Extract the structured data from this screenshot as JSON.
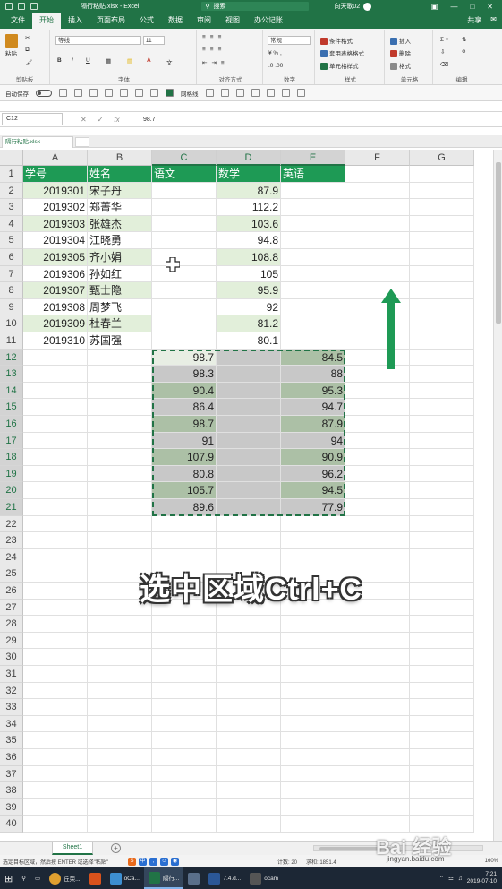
{
  "titlebar": {
    "title": "隔行粘贴.xlsx  -  Excel",
    "search": "搜索",
    "user": "向天歌02",
    "share": "共享"
  },
  "tabs": [
    "文件",
    "开始",
    "插入",
    "页面布局",
    "公式",
    "数据",
    "审阅",
    "视图",
    "办公记账"
  ],
  "ribbon": {
    "paste": "粘贴",
    "clipboard_label": "剪贴板",
    "font_name": "等线",
    "font_size": "11",
    "font_label": "字体",
    "align_label": "对齐方式",
    "number_format": "常规",
    "number_label": "数字",
    "cond_format": "条件格式",
    "table_format": "套用表格格式",
    "cell_style": "单元格样式",
    "style_label": "样式",
    "insert": "插入",
    "delete": "删除",
    "format": "格式",
    "cells_label": "单元格",
    "edit_label": "编辑"
  },
  "qbar": {
    "autosave": "自动保存",
    "gridlines": "网格线"
  },
  "formula": {
    "cell_ref": "C12",
    "value": "98.7"
  },
  "workbook_tab": "隔行粘贴.xlsx",
  "columns": [
    "A",
    "B",
    "C",
    "D",
    "E",
    "F",
    "G"
  ],
  "headers": [
    "学号",
    "姓名",
    "语文",
    "数学",
    "英语"
  ],
  "students": [
    {
      "id": "2019301",
      "name": "宋子丹",
      "math": "87.9"
    },
    {
      "id": "2019302",
      "name": "郑菁华",
      "math": "112.2"
    },
    {
      "id": "2019303",
      "name": "张雄杰",
      "math": "103.6"
    },
    {
      "id": "2019304",
      "name": "江晓勇",
      "math": "94.8"
    },
    {
      "id": "2019305",
      "name": "齐小娟",
      "math": "108.8"
    },
    {
      "id": "2019306",
      "name": "孙如红",
      "math": "105"
    },
    {
      "id": "2019307",
      "name": "甄士隐",
      "math": "95.9"
    },
    {
      "id": "2019308",
      "name": "周梦飞",
      "math": "92"
    },
    {
      "id": "2019309",
      "name": "杜春兰",
      "math": "81.2"
    },
    {
      "id": "2019310",
      "name": "苏国强",
      "math": "80.1"
    }
  ],
  "copied_block": [
    {
      "chinese": "98.7",
      "english": "84.5"
    },
    {
      "chinese": "98.3",
      "english": "88"
    },
    {
      "chinese": "90.4",
      "english": "95.3"
    },
    {
      "chinese": "86.4",
      "english": "94.7"
    },
    {
      "chinese": "98.7",
      "english": "87.9"
    },
    {
      "chinese": "91",
      "english": "94"
    },
    {
      "chinese": "107.9",
      "english": "90.9"
    },
    {
      "chinese": "80.8",
      "english": "96.2"
    },
    {
      "chinese": "105.7",
      "english": "94.5"
    },
    {
      "chinese": "89.6",
      "english": "77.9"
    }
  ],
  "row_numbers": [
    "1",
    "2",
    "3",
    "4",
    "5",
    "6",
    "7",
    "8",
    "9",
    "10",
    "11",
    "12",
    "13",
    "14",
    "15",
    "16",
    "17",
    "18",
    "19",
    "20",
    "21",
    "22",
    "23",
    "24",
    "25",
    "26",
    "27",
    "28",
    "29",
    "30",
    "31",
    "32",
    "33",
    "34",
    "35",
    "36",
    "37",
    "38",
    "39",
    "40"
  ],
  "overlay": "选中区域Ctrl+C",
  "sheet_tab": "Sheet1",
  "status": {
    "message": "选定目标区域，然后按 ENTER 或选择\"粘贴\"",
    "count": "计数: 20",
    "sum": "求和: 1851.4",
    "zoom": "160%"
  },
  "taskbar": {
    "items": [
      "丘荣...",
      "oCa...",
      "隔行...",
      "7.4.d...",
      "ocam"
    ],
    "time": "7:21",
    "date": "2019-07-10"
  },
  "watermark": "Bai 经验",
  "watermark_url": "jingyan.baidu.com",
  "colors": {
    "excel_green": "#217346",
    "header_green": "#1e9a55",
    "band_green": "#e2efda",
    "arrow_green": "#1e9a55"
  }
}
